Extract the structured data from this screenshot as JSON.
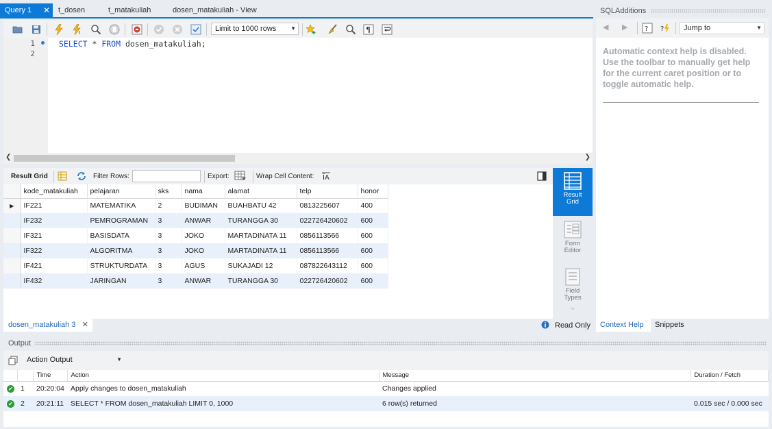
{
  "tabs": [
    {
      "label": "Query 1",
      "active": true
    },
    {
      "label": "t_dosen",
      "active": false
    },
    {
      "label": "t_matakuliah",
      "active": false
    },
    {
      "label": "dosen_matakuliah - View",
      "active": false
    }
  ],
  "toolbar": {
    "limit_label": "Limit to 1000 rows"
  },
  "editor": {
    "line_numbers": [
      "1",
      "2"
    ],
    "sql_keyword1": "SELECT",
    "sql_star": " * ",
    "sql_keyword2": "FROM",
    "sql_rest": " dosen_matakuliah;"
  },
  "result_toolbar": {
    "result_grid": "Result Grid",
    "filter_rows": "Filter Rows:",
    "filter_value": "",
    "export": "Export:",
    "wrap": "Wrap Cell Content:"
  },
  "grid": {
    "columns": [
      "kode_matakuliah",
      "pelajaran",
      "sks",
      "nama",
      "alamat",
      "telp",
      "honor"
    ],
    "rows": [
      [
        "IF221",
        "MATEMATIKA",
        "2",
        "BUDIMAN",
        "BUAHBATU 42",
        "0813225607",
        "400"
      ],
      [
        "IF232",
        "PEMROGRAMAN",
        "3",
        "ANWAR",
        "TURANGGA 30",
        "022726420602",
        "600"
      ],
      [
        "IF321",
        "BASISDATA",
        "3",
        "JOKO",
        "MARTADINATA 11",
        "0856113566",
        "600"
      ],
      [
        "IF322",
        "ALGORITMA",
        "3",
        "JOKO",
        "MARTADINATA 11",
        "0856113566",
        "600"
      ],
      [
        "IF421",
        "STRUKTURDATA",
        "3",
        "AGUS",
        "SUKAJADI 12",
        "087822643112",
        "600"
      ],
      [
        "IF432",
        "JARINGAN",
        "3",
        "ANWAR",
        "TURANGGA 30",
        "022726420602",
        "600"
      ]
    ]
  },
  "side_panel": {
    "result_grid_1": "Result",
    "result_grid_2": "Grid",
    "form_editor_1": "Form",
    "form_editor_2": "Editor",
    "field_types_1": "Field",
    "field_types_2": "Types"
  },
  "result_tabs": {
    "tab_label": "dosen_matakuliah 3",
    "read_only": "Read Only"
  },
  "sql_additions": {
    "title": "SQLAdditions",
    "jump_to": "Jump to",
    "help_text": "Automatic context help is disabled. Use the toolbar to manually get help for the current caret position or to toggle automatic help.",
    "context_help_tab": "Context Help",
    "snippets_tab": "Snippets"
  },
  "output": {
    "title": "Output",
    "mode": "Action Output",
    "columns": [
      "",
      "Time",
      "Action",
      "Message",
      "Duration / Fetch"
    ],
    "rows": [
      {
        "num": "1",
        "time": "20:20:04",
        "action": "Apply changes to dosen_matakuliah",
        "message": "Changes applied",
        "duration": ""
      },
      {
        "num": "2",
        "time": "20:21:11",
        "action": "SELECT * FROM dosen_matakuliah LIMIT 0, 1000",
        "message": "6 row(s) returned",
        "duration": "0.015 sec / 0.000 sec"
      }
    ]
  },
  "colors": {
    "accent": "#0d7ad8",
    "alt_row": "#e8f0fb",
    "ok_green": "#2e9b38"
  }
}
